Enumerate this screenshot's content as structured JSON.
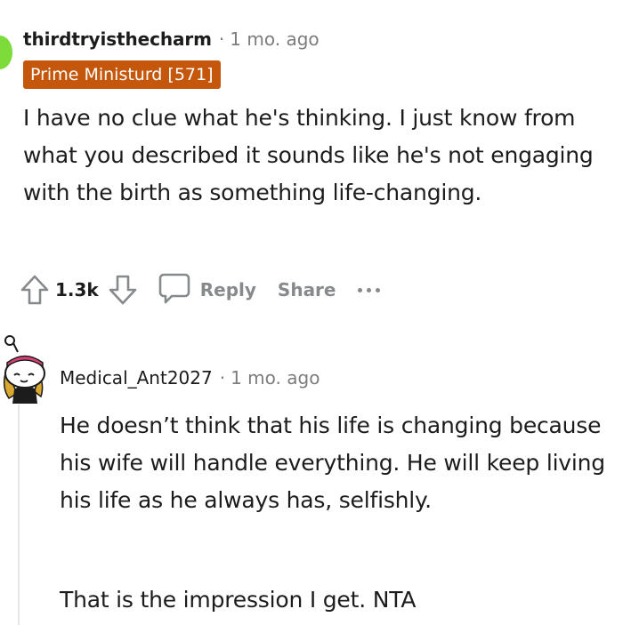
{
  "top_comment": {
    "username": "thirdtryisthecharm",
    "separator": "·",
    "time": "1 mo. ago",
    "flair": "Prime Ministurd [571]",
    "body": "I have no clue what he's thinking. I just know from what you described it sounds like he's not engaging with the birth as something life-changing.",
    "vote_count": "1.3k",
    "reply_label": "Reply",
    "share_label": "Share",
    "avatar_color": "#7ddc3a",
    "flair_color": "#c4570c"
  },
  "reply_comment": {
    "username": "Medical_Ant2027",
    "separator": "·",
    "time": "1 mo. ago",
    "body_paragraph_1": "He doesn’t think that his life is changing because his wife will handle everything. He will keep living his life as he always has, selfishly.",
    "body_paragraph_2": "That is the impression I get. NTA"
  },
  "icons": {
    "upvote": "upvote-arrow-icon",
    "downvote": "downvote-arrow-icon",
    "reply": "speech-bubble-icon",
    "more": "ellipsis-icon",
    "avatar": "snoo-avatar-icon"
  }
}
